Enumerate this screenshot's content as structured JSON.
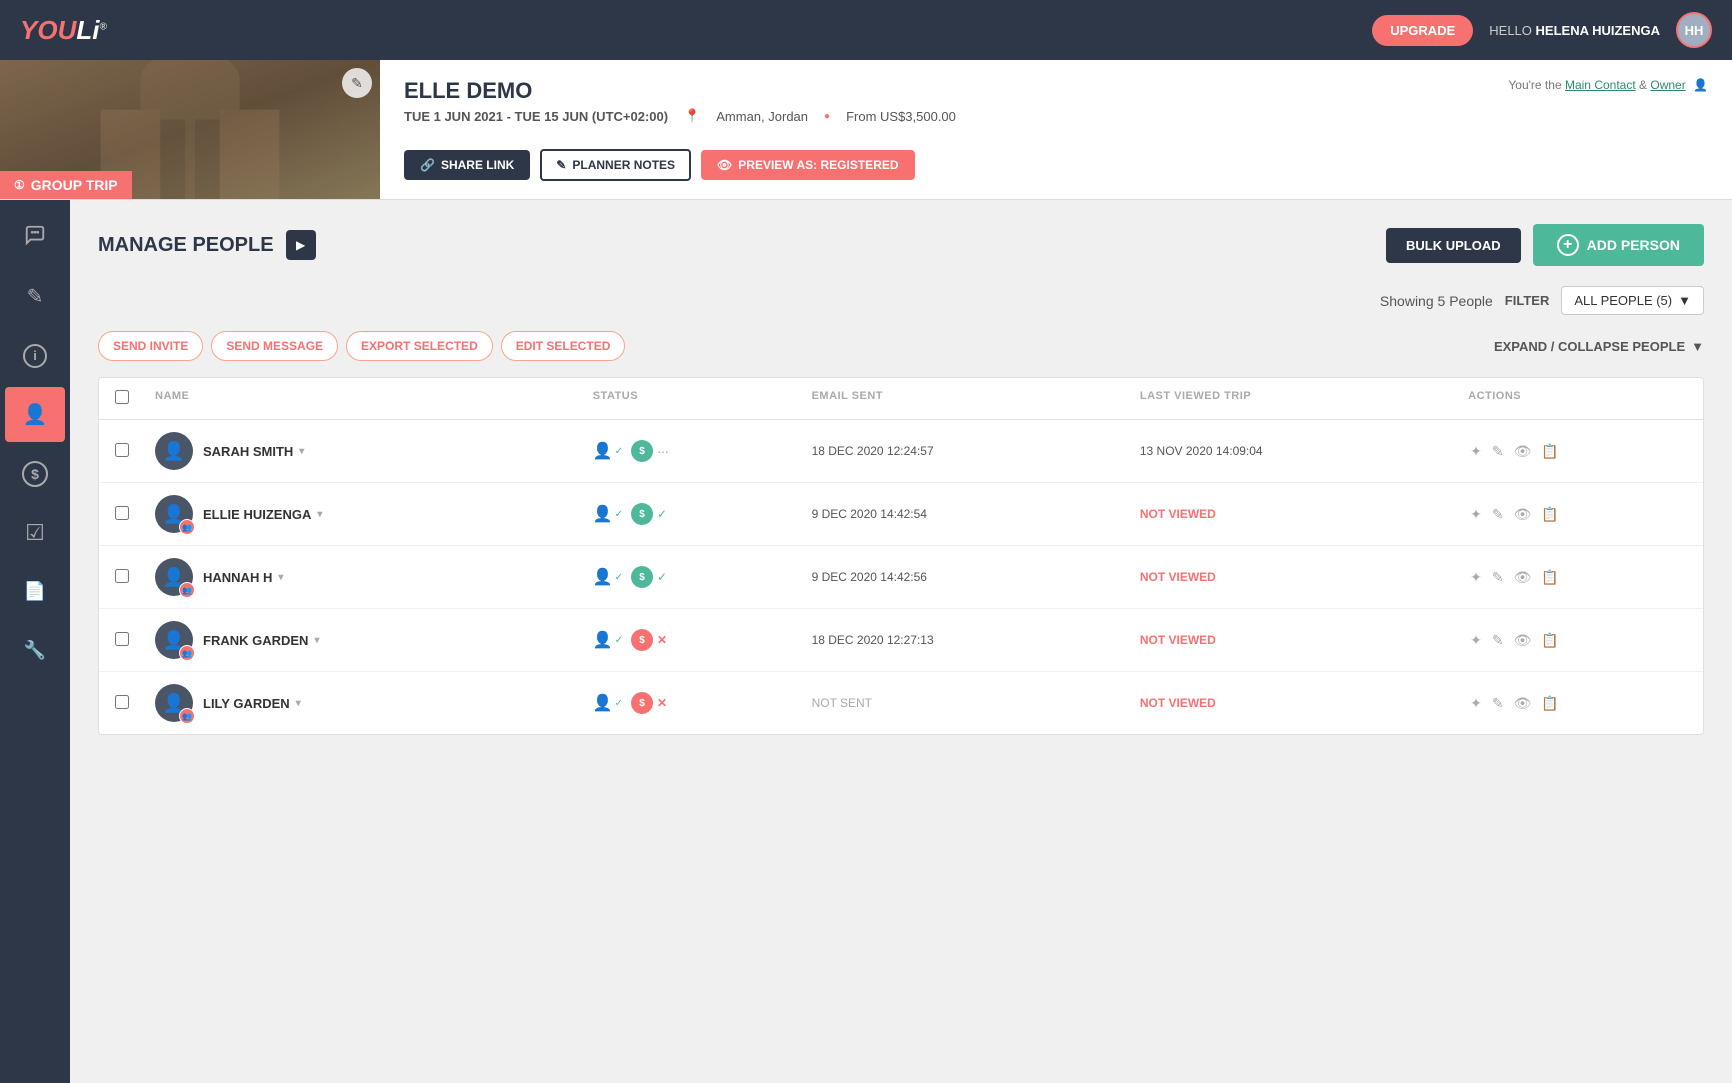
{
  "app": {
    "logo": "YOULi",
    "nav": {
      "upgrade_label": "UPGRADE",
      "hello_prefix": "HELLO",
      "user_name": "HELENA HUIZENGA"
    }
  },
  "trip": {
    "title": "ELLE DEMO",
    "date_range": "TUE 1 JUN 2021 - TUE 15 JUN (UTC+02:00)",
    "location": "Amman, Jordan",
    "price": "From US$3,500.00",
    "badge": "GROUP TRIP",
    "owner_text": "You're the",
    "main_contact": "Main Contact",
    "and": "&",
    "owner": "Owner",
    "actions": {
      "share_link": "SHARE LINK",
      "planner_notes": "PLANNER NOTES",
      "preview": "PREVIEW AS: REGISTERED"
    }
  },
  "sidebar": {
    "items": [
      {
        "id": "chat",
        "icon": "chat-icon"
      },
      {
        "id": "pencil",
        "icon": "pencil-icon"
      },
      {
        "id": "info",
        "icon": "info-icon"
      },
      {
        "id": "person",
        "icon": "person-icon",
        "active": true
      },
      {
        "id": "dollar",
        "icon": "dollar-icon"
      },
      {
        "id": "check",
        "icon": "check-icon"
      },
      {
        "id": "doc",
        "icon": "doc-icon"
      },
      {
        "id": "wrench",
        "icon": "wrench-icon"
      }
    ]
  },
  "manage_people": {
    "title": "MANAGE PEOPLE",
    "bulk_upload": "BULK UPLOAD",
    "add_person": "ADD PERSON",
    "showing": "Showing 5 People",
    "filter_label": "FILTER",
    "filter_value": "ALL PEOPLE (5)",
    "expand_collapse": "EXPAND / COLLAPSE PEOPLE",
    "bulk_actions": {
      "send_invite": "SEND INVITE",
      "send_message": "SEND MESSAGE",
      "export_selected": "EXPORT SELECTED",
      "edit_selected": "EDIT SELECTED"
    },
    "table": {
      "headers": [
        "",
        "NAME",
        "STATUS",
        "EMAIL SENT",
        "LAST VIEWED TRIP",
        "ACTIONS"
      ],
      "people": [
        {
          "name": "SARAH SMITH",
          "status_person": "checked",
          "status_dollar": "dots",
          "dollar_type": "green",
          "email_sent": "18 DEC 2020 12:24:57",
          "last_viewed": "13 NOV 2020 14:09:04",
          "last_viewed_type": "date",
          "has_badge": false
        },
        {
          "name": "ELLIE HUIZENGA",
          "status_person": "checked",
          "status_dollar": "check",
          "dollar_type": "green",
          "email_sent": "9 DEC 2020 14:42:54",
          "last_viewed": "NOT VIEWED",
          "last_viewed_type": "not_viewed",
          "has_badge": true
        },
        {
          "name": "HANNAH H",
          "status_person": "checked",
          "status_dollar": "check",
          "dollar_type": "green",
          "email_sent": "9 DEC 2020 14:42:56",
          "last_viewed": "NOT VIEWED",
          "last_viewed_type": "not_viewed",
          "has_badge": true
        },
        {
          "name": "FRANK GARDEN",
          "status_person": "checked",
          "status_dollar": "x",
          "dollar_type": "red",
          "email_sent": "18 DEC 2020 12:27:13",
          "last_viewed": "NOT VIEWED",
          "last_viewed_type": "not_viewed",
          "has_badge": true
        },
        {
          "name": "LILY GARDEN",
          "status_person": "checked",
          "status_dollar": "x",
          "dollar_type": "red",
          "email_sent": "NOT SENT",
          "last_viewed": "NOT VIEWED",
          "last_viewed_type": "not_viewed",
          "has_badge": true
        }
      ]
    }
  }
}
